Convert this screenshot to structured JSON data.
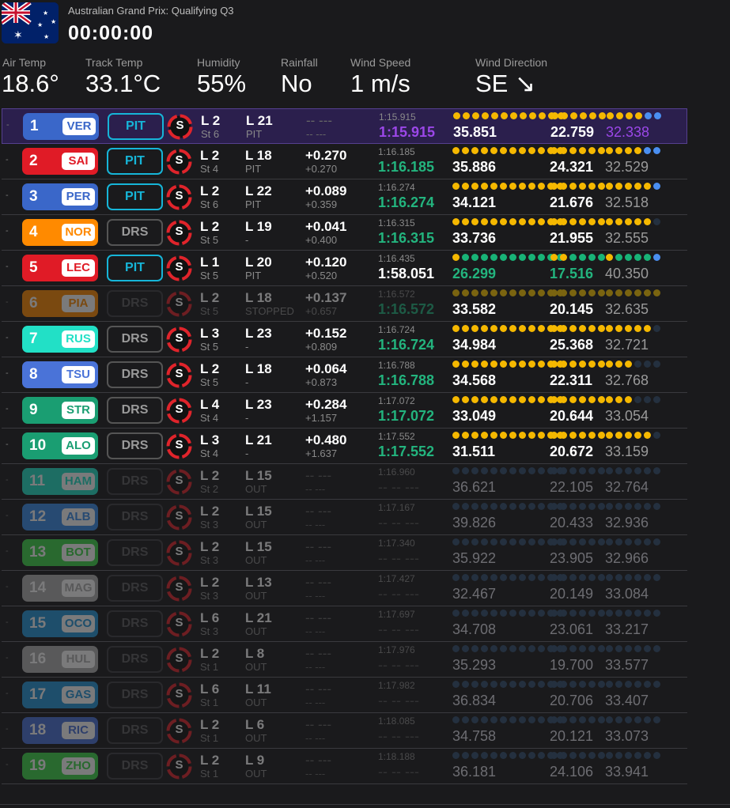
{
  "session": {
    "title": "Australian Grand Prix: Qualifying Q3",
    "clock": "00:00:00",
    "flag_icon": "australia-flag-icon"
  },
  "weather": [
    {
      "label": "Air Temp",
      "value": "18.6°"
    },
    {
      "label": "Track Temp",
      "value": "33.1°C"
    },
    {
      "label": "Humidity",
      "value": "55%"
    },
    {
      "label": "Rainfall",
      "value": "No"
    },
    {
      "label": "Wind Speed",
      "value": "1 m/s"
    },
    {
      "label": "Wind Direction",
      "value": "SE ↘"
    }
  ],
  "colors": {
    "drs_pit": "#16b5d8",
    "sector_purple": "#9b47e8",
    "sector_green": "#23b47e",
    "mini_yellow": "#f5b800",
    "mini_green": "#18b377",
    "mini_blue": "#4a8ff0",
    "soft_tyre": "#e0242b",
    "highlight_row": "#2b1f4d"
  },
  "drivers": [
    {
      "pos": "1",
      "tla": "VER",
      "team_color": "#3a67c9",
      "tla_color": "#3a67c9",
      "drs": "PIT",
      "tyre": "S",
      "stint": "L 2",
      "stint_sub": "St 6",
      "lap": "L 21",
      "lap_status": "PIT",
      "gap": "-- ---",
      "gap2": "-- ---",
      "best": "1:15.915",
      "last": "1:15.915",
      "last_style": "purple",
      "s1": "35.851",
      "s1_style": "white",
      "s2": "22.759",
      "s2_style": "white",
      "s3": "32.338",
      "s3_style": "purple",
      "minis1": "YYYYYYYYYYYY",
      "minis2": "YYYYYY",
      "minis3": "YYYYBB",
      "highlight": true,
      "dim": false
    },
    {
      "pos": "2",
      "tla": "SAI",
      "team_color": "#e01b26",
      "tla_color": "#e01b26",
      "drs": "PIT",
      "tyre": "S",
      "stint": "L 2",
      "stint_sub": "St 4",
      "lap": "L 18",
      "lap_status": "PIT",
      "gap": "+0.270",
      "gap2": "+0.270",
      "best": "1:16.185",
      "last": "1:16.185",
      "last_style": "green",
      "s1": "35.886",
      "s1_style": "white",
      "s2": "24.321",
      "s2_style": "white",
      "s3": "32.529",
      "s3_style": "grey",
      "minis1": "YYYYYYYYYYYY",
      "minis2": "YYYYYY",
      "minis3": "YYYYBB",
      "highlight": false,
      "dim": false
    },
    {
      "pos": "3",
      "tla": "PER",
      "team_color": "#3a67c9",
      "tla_color": "#3a67c9",
      "drs": "PIT",
      "tyre": "S",
      "stint": "L 2",
      "stint_sub": "St 6",
      "lap": "L 22",
      "lap_status": "PIT",
      "gap": "+0.089",
      "gap2": "+0.359",
      "best": "1:16.274",
      "last": "1:16.274",
      "last_style": "green",
      "s1": "34.121",
      "s1_style": "white",
      "s2": "21.676",
      "s2_style": "white",
      "s3": "32.518",
      "s3_style": "grey",
      "minis1": "YYYYYYYYYYYY",
      "minis2": "YYYYYY",
      "minis3": "YYYYYB",
      "highlight": false,
      "dim": false
    },
    {
      "pos": "4",
      "tla": "NOR",
      "team_color": "#ff8a00",
      "tla_color": "#ff8a00",
      "drs": "DRS",
      "tyre": "S",
      "stint": "L 2",
      "stint_sub": "St 5",
      "lap": "L 19",
      "lap_status": "-",
      "gap": "+0.041",
      "gap2": "+0.400",
      "best": "1:16.315",
      "last": "1:16.315",
      "last_style": "green",
      "s1": "33.736",
      "s1_style": "white",
      "s2": "21.955",
      "s2_style": "white",
      "s3": "32.555",
      "s3_style": "grey",
      "minis1": "YYYYYYYYYYYY",
      "minis2": "YYYYYY",
      "minis3": "YYYYYN",
      "highlight": false,
      "dim": false
    },
    {
      "pos": "5",
      "tla": "LEC",
      "team_color": "#e01b26",
      "tla_color": "#e01b26",
      "drs": "PIT",
      "tyre": "S",
      "stint": "L 1",
      "stint_sub": "St 5",
      "lap": "L 20",
      "lap_status": "PIT",
      "gap": "+0.120",
      "gap2": "+0.520",
      "best": "1:16.435",
      "last": "1:58.051",
      "last_style": "white",
      "s1": "26.299",
      "s1_style": "green",
      "s2": "17.516",
      "s2_style": "green",
      "s3": "40.350",
      "s3_style": "grey",
      "minis1": "YGGGGGGGGGGG",
      "minis2": "YYGGGG",
      "minis3": "YGGGGB",
      "highlight": false,
      "dim": false
    },
    {
      "pos": "6",
      "tla": "PIA",
      "team_color": "#ff8a00",
      "tla_color": "#ff8a00",
      "drs": "DRS",
      "tyre": "S",
      "stint": "L 2",
      "stint_sub": "St 5",
      "lap": "L 18",
      "lap_status": "STOPPED",
      "gap": "+0.137",
      "gap2": "+0.657",
      "best": "1:16.572",
      "last": "1:16.572",
      "last_style": "green",
      "s1": "33.582",
      "s1_style": "white",
      "s2": "20.145",
      "s2_style": "white",
      "s3": "32.635",
      "s3_style": "grey",
      "minis1": "yyyyyyyyyyyy",
      "minis2": "yyyyyy",
      "minis3": "yyyyyy",
      "highlight": false,
      "dim": true
    },
    {
      "pos": "7",
      "tla": "RUS",
      "team_color": "#22e0c6",
      "tla_color": "#22e0c6",
      "drs": "DRS",
      "tyre": "S",
      "stint": "L 3",
      "stint_sub": "St 5",
      "lap": "L 23",
      "lap_status": "-",
      "gap": "+0.152",
      "gap2": "+0.809",
      "best": "1:16.724",
      "last": "1:16.724",
      "last_style": "green",
      "s1": "34.984",
      "s1_style": "white",
      "s2": "25.368",
      "s2_style": "white",
      "s3": "32.721",
      "s3_style": "grey",
      "minis1": "YYYYYYYYYYYY",
      "minis2": "YYYYYY",
      "minis3": "YYYYYN",
      "highlight": false,
      "dim": false
    },
    {
      "pos": "8",
      "tla": "TSU",
      "team_color": "#4a73d8",
      "tla_color": "#4a73d8",
      "drs": "DRS",
      "tyre": "S",
      "stint": "L 2",
      "stint_sub": "St 5",
      "lap": "L 18",
      "lap_status": "-",
      "gap": "+0.064",
      "gap2": "+0.873",
      "best": "1:16.788",
      "last": "1:16.788",
      "last_style": "green",
      "s1": "34.568",
      "s1_style": "white",
      "s2": "22.311",
      "s2_style": "white",
      "s3": "32.768",
      "s3_style": "grey",
      "minis1": "YYYYYYYYYYYY",
      "minis2": "YYYYYY",
      "minis3": "YYYNNN",
      "highlight": false,
      "dim": false
    },
    {
      "pos": "9",
      "tla": "STR",
      "team_color": "#1a9e72",
      "tla_color": "#1a9e72",
      "drs": "DRS",
      "tyre": "S",
      "stint": "L 4",
      "stint_sub": "St 4",
      "lap": "L 23",
      "lap_status": "-",
      "gap": "+0.284",
      "gap2": "+1.157",
      "best": "1:17.072",
      "last": "1:17.072",
      "last_style": "green",
      "s1": "33.049",
      "s1_style": "white",
      "s2": "20.644",
      "s2_style": "white",
      "s3": "33.054",
      "s3_style": "grey",
      "minis1": "YYYYYYYYYYYY",
      "minis2": "YYYYYY",
      "minis3": "YYYNNN",
      "highlight": false,
      "dim": false
    },
    {
      "pos": "10",
      "tla": "ALO",
      "team_color": "#1a9e72",
      "tla_color": "#1a9e72",
      "drs": "DRS",
      "tyre": "S",
      "stint": "L 3",
      "stint_sub": "St 4",
      "lap": "L 21",
      "lap_status": "-",
      "gap": "+0.480",
      "gap2": "+1.637",
      "best": "1:17.552",
      "last": "1:17.552",
      "last_style": "green",
      "s1": "31.511",
      "s1_style": "white",
      "s2": "20.672",
      "s2_style": "white",
      "s3": "33.159",
      "s3_style": "grey",
      "minis1": "YYYYYYYYYYYY",
      "minis2": "YYYYYY",
      "minis3": "YYYYYN",
      "highlight": false,
      "dim": false
    },
    {
      "pos": "11",
      "tla": "HAM",
      "team_color": "#22e0c6",
      "tla_color": "#22e0c6",
      "drs": "DRS",
      "tyre": "S",
      "stint": "L 2",
      "stint_sub": "St 2",
      "lap": "L 15",
      "lap_status": "OUT",
      "gap": "-- ---",
      "gap2": "-- ---",
      "best": "1:16.960",
      "last": "-- -- ---",
      "last_style": "none",
      "s1": "36.621",
      "s1_style": "dim",
      "s2": "22.105",
      "s2_style": "dim",
      "s3": "32.764",
      "s3_style": "dim",
      "minis1": "NNNNNNNNNNNN",
      "minis2": "NNNNNN",
      "minis3": "NNNNNN",
      "highlight": false,
      "dim": true
    },
    {
      "pos": "12",
      "tla": "ALB",
      "team_color": "#3b8de8",
      "tla_color": "#3b8de8",
      "drs": "DRS",
      "tyre": "S",
      "stint": "L 2",
      "stint_sub": "St 3",
      "lap": "L 15",
      "lap_status": "OUT",
      "gap": "-- ---",
      "gap2": "-- ---",
      "best": "1:17.167",
      "last": "-- -- ---",
      "last_style": "none",
      "s1": "39.826",
      "s1_style": "dim",
      "s2": "20.433",
      "s2_style": "dim",
      "s3": "32.936",
      "s3_style": "dim",
      "minis1": "NNNNNNNNNNNN",
      "minis2": "NNNNNN",
      "minis3": "NNNNNN",
      "highlight": false,
      "dim": true
    },
    {
      "pos": "13",
      "tla": "BOT",
      "team_color": "#3fd64a",
      "tla_color": "#3fd64a",
      "drs": "DRS",
      "tyre": "S",
      "stint": "L 2",
      "stint_sub": "St 3",
      "lap": "L 15",
      "lap_status": "OUT",
      "gap": "-- ---",
      "gap2": "-- ---",
      "best": "1:17.340",
      "last": "-- -- ---",
      "last_style": "none",
      "s1": "35.922",
      "s1_style": "dim",
      "s2": "23.905",
      "s2_style": "dim",
      "s3": "32.966",
      "s3_style": "dim",
      "minis1": "NNNNNNNNNNNN",
      "minis2": "NNNNNN",
      "minis3": "NNNNNN",
      "highlight": false,
      "dim": true
    },
    {
      "pos": "14",
      "tla": "MAG",
      "team_color": "#b0b0b0",
      "tla_color": "#b0b0b0",
      "drs": "DRS",
      "tyre": "S",
      "stint": "L 2",
      "stint_sub": "St 3",
      "lap": "L 13",
      "lap_status": "OUT",
      "gap": "-- ---",
      "gap2": "-- ---",
      "best": "1:17.427",
      "last": "-- -- ---",
      "last_style": "none",
      "s1": "32.467",
      "s1_style": "dim",
      "s2": "20.149",
      "s2_style": "dim",
      "s3": "33.084",
      "s3_style": "dim",
      "minis1": "NNNNNNNNNNNN",
      "minis2": "NNNNNN",
      "minis3": "NNNNNN",
      "highlight": false,
      "dim": true
    },
    {
      "pos": "15",
      "tla": "OCO",
      "team_color": "#2596d8",
      "tla_color": "#2596d8",
      "drs": "DRS",
      "tyre": "S",
      "stint": "L 6",
      "stint_sub": "St 3",
      "lap": "L 21",
      "lap_status": "OUT",
      "gap": "-- ---",
      "gap2": "-- ---",
      "best": "1:17.697",
      "last": "-- -- ---",
      "last_style": "none",
      "s1": "34.708",
      "s1_style": "dim",
      "s2": "23.061",
      "s2_style": "dim",
      "s3": "33.217",
      "s3_style": "dim",
      "minis1": "NNNNNNNNNNNN",
      "minis2": "NNNNNN",
      "minis3": "NNNNNN",
      "highlight": false,
      "dim": true
    },
    {
      "pos": "16",
      "tla": "HUL",
      "team_color": "#b0b0b0",
      "tla_color": "#b0b0b0",
      "drs": "DRS",
      "tyre": "S",
      "stint": "L 2",
      "stint_sub": "St 1",
      "lap": "L 8",
      "lap_status": "OUT",
      "gap": "-- ---",
      "gap2": "-- ---",
      "best": "1:17.976",
      "last": "-- -- ---",
      "last_style": "none",
      "s1": "35.293",
      "s1_style": "dim",
      "s2": "19.700",
      "s2_style": "dim",
      "s3": "33.577",
      "s3_style": "dim",
      "minis1": "NNNNNNNNNNNN",
      "minis2": "NNNNNN",
      "minis3": "NNNNNN",
      "highlight": false,
      "dim": true
    },
    {
      "pos": "17",
      "tla": "GAS",
      "team_color": "#2596d8",
      "tla_color": "#2596d8",
      "drs": "DRS",
      "tyre": "S",
      "stint": "L 6",
      "stint_sub": "St 1",
      "lap": "L 11",
      "lap_status": "OUT",
      "gap": "-- ---",
      "gap2": "-- ---",
      "best": "1:17.982",
      "last": "-- -- ---",
      "last_style": "none",
      "s1": "36.834",
      "s1_style": "dim",
      "s2": "20.706",
      "s2_style": "dim",
      "s3": "33.407",
      "s3_style": "dim",
      "minis1": "NNNNNNNNNNNN",
      "minis2": "NNNNNN",
      "minis3": "NNNNNN",
      "highlight": false,
      "dim": true
    },
    {
      "pos": "18",
      "tla": "RIC",
      "team_color": "#4a73d8",
      "tla_color": "#4a73d8",
      "drs": "DRS",
      "tyre": "S",
      "stint": "L 2",
      "stint_sub": "St 1",
      "lap": "L 6",
      "lap_status": "OUT",
      "gap": "-- ---",
      "gap2": "-- ---",
      "best": "1:18.085",
      "last": "-- -- ---",
      "last_style": "none",
      "s1": "34.758",
      "s1_style": "dim",
      "s2": "20.121",
      "s2_style": "dim",
      "s3": "33.073",
      "s3_style": "dim",
      "minis1": "NNNNNNNNNNNN",
      "minis2": "NNNNNN",
      "minis3": "NNNNNN",
      "highlight": false,
      "dim": true
    },
    {
      "pos": "19",
      "tla": "ZHO",
      "team_color": "#3fd64a",
      "tla_color": "#3fd64a",
      "drs": "DRS",
      "tyre": "S",
      "stint": "L 2",
      "stint_sub": "St 1",
      "lap": "L 9",
      "lap_status": "OUT",
      "gap": "-- ---",
      "gap2": "-- ---",
      "best": "1:18.188",
      "last": "-- -- ---",
      "last_style": "none",
      "s1": "36.181",
      "s1_style": "dim",
      "s2": "24.106",
      "s2_style": "dim",
      "s3": "33.941",
      "s3_style": "dim",
      "minis1": "NNNNNNNNNNNN",
      "minis2": "NNNNNN",
      "minis3": "NNNNNN",
      "highlight": false,
      "dim": true
    }
  ]
}
